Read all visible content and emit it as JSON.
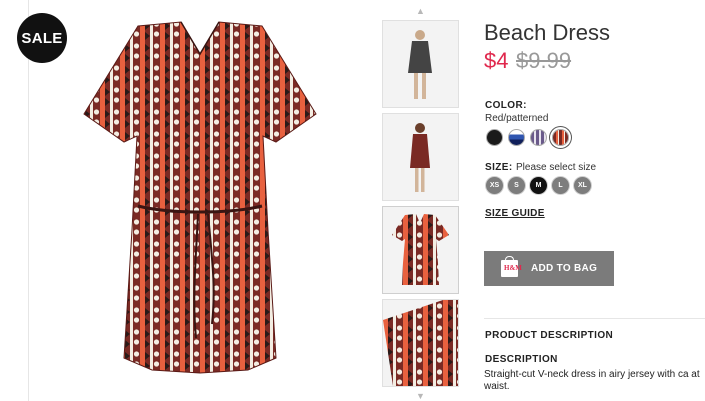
{
  "badge": {
    "sale": "SALE"
  },
  "product": {
    "title": "Beach Dress",
    "price": "$4",
    "old_price": "$9.99"
  },
  "color": {
    "label": "COLOR:",
    "selected": "Red/patterned",
    "swatches": [
      {
        "name": "black",
        "color": "#1a1a1a"
      },
      {
        "name": "blue-striped",
        "color": "#3b5fb5"
      },
      {
        "name": "purple-patterned",
        "color": "#7a6d9a"
      },
      {
        "name": "red-patterned",
        "color": "#8a2a2a"
      }
    ]
  },
  "size": {
    "label": "SIZE:",
    "prompt": "Please select size",
    "options": [
      "XS",
      "S",
      "M",
      "L",
      "XL"
    ],
    "selected": "M"
  },
  "size_guide": "SIZE GUIDE",
  "add_to_bag": "ADD TO BAG",
  "product_description": {
    "heading": "PRODUCT DESCRIPTION",
    "sub_heading": "DESCRIPTION",
    "text": "Straight-cut V-neck dress in airy jersey with ca at waist."
  },
  "icons": {
    "bag": "shopping-bag-icon",
    "up": "chevron-up-icon",
    "down": "chevron-down-icon"
  },
  "colors": {
    "price": "#e0284d",
    "button": "#7b7b7b"
  }
}
